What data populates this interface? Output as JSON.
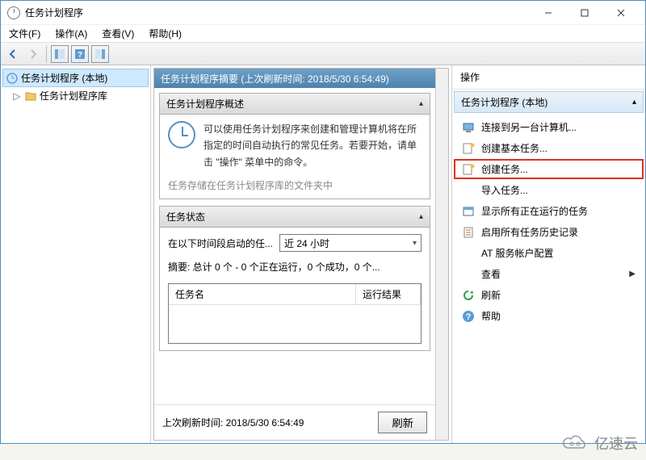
{
  "window": {
    "title": "任务计划程序"
  },
  "menu": {
    "file": "文件(F)",
    "action": "操作(A)",
    "view": "查看(V)",
    "help": "帮助(H)"
  },
  "tree": {
    "root": "任务计划程序 (本地)",
    "child": "任务计划程序库"
  },
  "summary": {
    "header": "任务计划程序摘要 (上次刷新时间: 2018/5/30 6:54:49)",
    "overview_title": "任务计划程序概述",
    "overview_text": "可以使用任务计划程序来创建和管理计算机将在所指定的时间自动执行的常见任务。若要开始，请单击 \"操作\" 菜单中的命令。",
    "overview_more": "任务存储在任务计划程序库的文件夹中",
    "status_title": "任务状态",
    "range_label": "在以下时间段启动的任...",
    "range_value": "近 24 小时",
    "digest": "摘要: 总计 0 个 - 0 个正在运行，0 个成功，0 个...",
    "col_name": "任务名",
    "col_result": "运行结果",
    "last_refresh": "上次刷新时间: 2018/5/30 6:54:49",
    "refresh_btn": "刷新"
  },
  "actions": {
    "pane_title": "操作",
    "subhead": "任务计划程序 (本地)",
    "items": {
      "connect": "连接到另一台计算机...",
      "create_basic": "创建基本任务...",
      "create_task": "创建任务...",
      "import": "导入任务...",
      "show_running": "显示所有正在运行的任务",
      "enable_history": "启用所有任务历史记录",
      "at_account": "AT 服务帐户配置",
      "view": "查看",
      "refresh": "刷新",
      "help": "帮助"
    }
  },
  "watermark": "亿速云"
}
